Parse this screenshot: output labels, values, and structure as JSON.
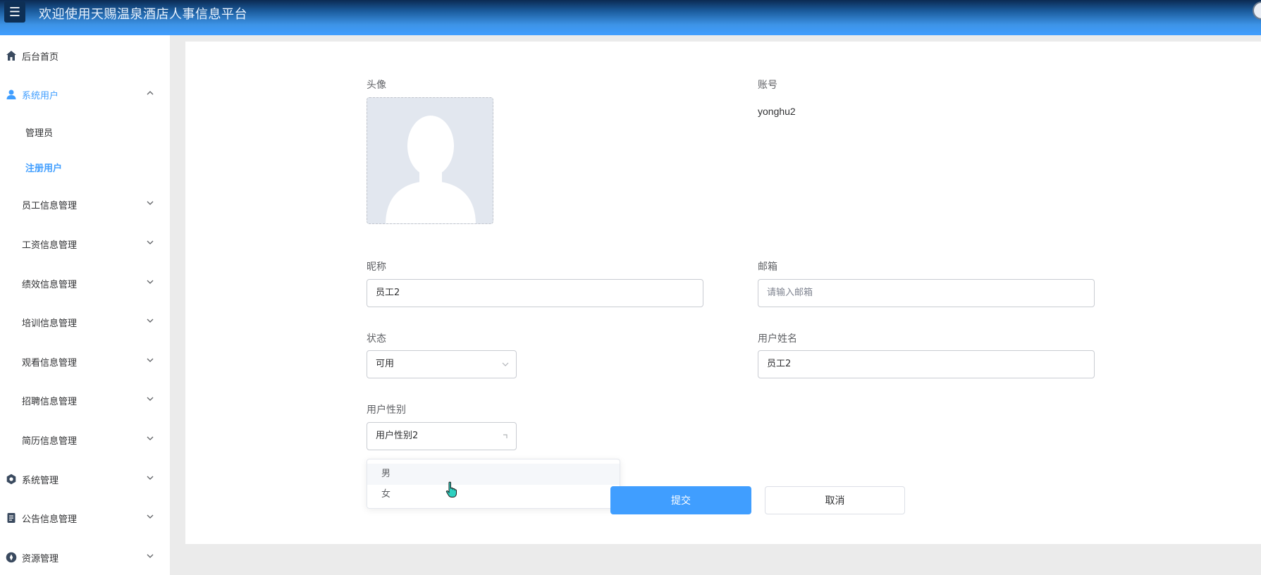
{
  "header": {
    "title": "欢迎使用天赐温泉酒店人事信息平台",
    "menu_icon": "hamburger-icon"
  },
  "sidebar": {
    "items": [
      {
        "label": "后台首页",
        "icon": "home-icon"
      },
      {
        "label": "系统用户",
        "icon": "user-icon",
        "expanded": true
      },
      {
        "label": "员工信息管理",
        "icon": "grid-icon"
      },
      {
        "label": "工资信息管理",
        "icon": "grid-icon"
      },
      {
        "label": "绩效信息管理",
        "icon": "grid-icon"
      },
      {
        "label": "培训信息管理",
        "icon": "grid-icon"
      },
      {
        "label": "观看信息管理",
        "icon": "grid-icon"
      },
      {
        "label": "招聘信息管理",
        "icon": "grid-icon"
      },
      {
        "label": "简历信息管理",
        "icon": "grid-icon"
      },
      {
        "label": "系统管理",
        "icon": "gear-icon"
      },
      {
        "label": "公告信息管理",
        "icon": "document-icon"
      },
      {
        "label": "资源管理",
        "icon": "compass-icon"
      }
    ],
    "sub_items": [
      {
        "label": "管理员"
      },
      {
        "label": "注册用户",
        "active": true
      }
    ]
  },
  "form": {
    "avatar_label": "头像",
    "account_label": "账号",
    "account_value": "yonghu2",
    "nickname_label": "昵称",
    "nickname_value": "员工2",
    "email_label": "邮箱",
    "email_placeholder": "请输入邮箱",
    "status_label": "状态",
    "status_value": "可用",
    "username_label": "用户姓名",
    "username_value": "员工2",
    "gender_label": "用户性别",
    "gender_value": "用户性别2",
    "gender_options": [
      "男",
      "女"
    ]
  },
  "buttons": {
    "submit": "提交",
    "cancel": "取消"
  },
  "colors": {
    "primary": "#409eff",
    "header_dark": "#0b2a52",
    "sidebar_bg": "#ffffff",
    "page_bg": "#ebebeb"
  }
}
